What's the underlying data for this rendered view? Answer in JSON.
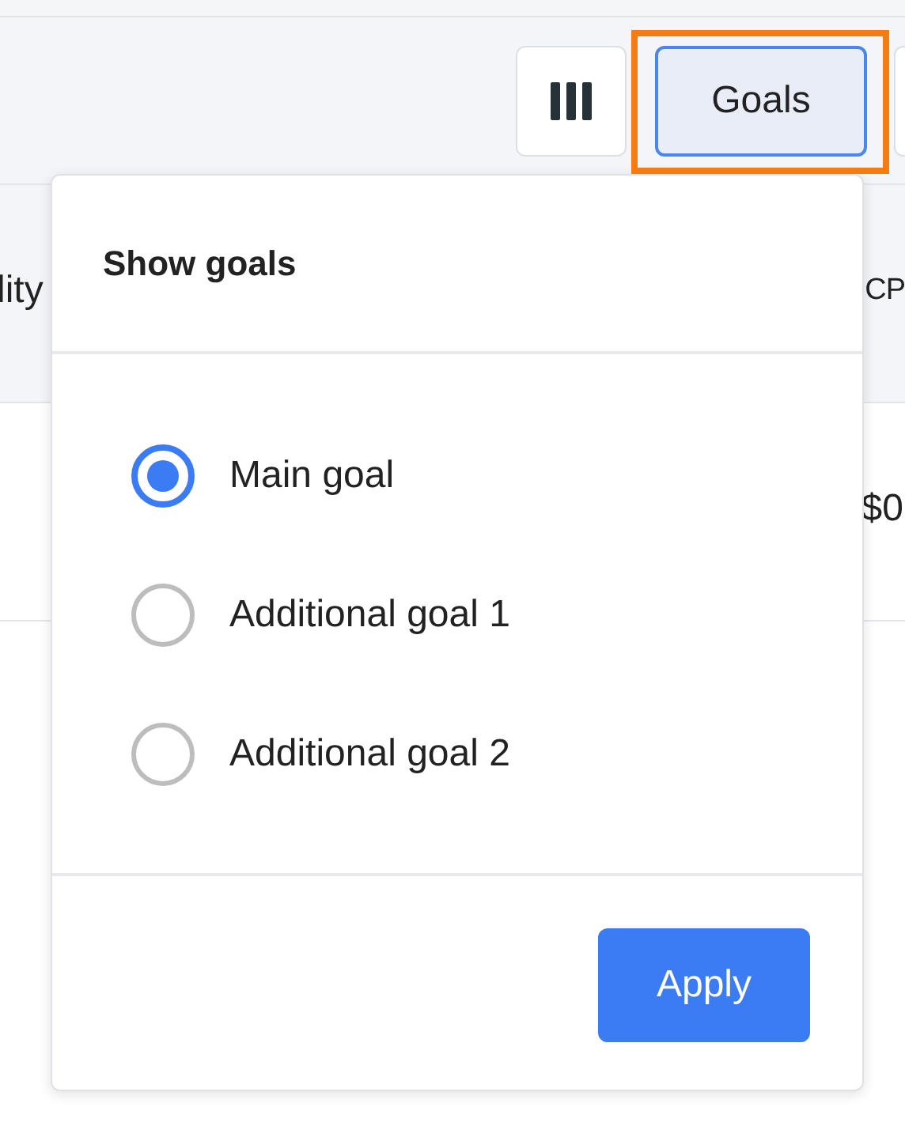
{
  "toolbar": {
    "goals_button": {
      "label": "Goals",
      "active": true,
      "highlighted": true
    }
  },
  "table": {
    "columns": [
      {
        "label": "lity"
      },
      {
        "label": "CP"
      }
    ],
    "rows": [
      {
        "column_2": "$0"
      }
    ]
  },
  "goals_popup": {
    "title": "Show goals",
    "options": [
      {
        "label": "Main goal",
        "selected": true
      },
      {
        "label": "Additional goal 1",
        "selected": false
      },
      {
        "label": "Additional goal 2",
        "selected": false
      }
    ],
    "apply_button": "Apply"
  }
}
